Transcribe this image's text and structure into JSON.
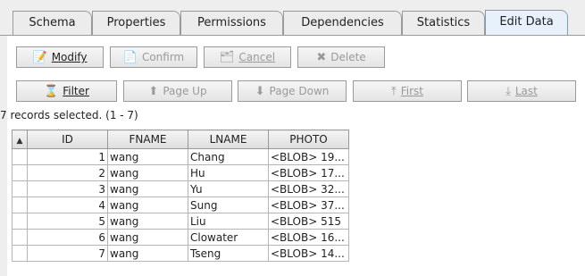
{
  "tabs": [
    {
      "label": "Schema"
    },
    {
      "label": "Properties"
    },
    {
      "label": "Permissions"
    },
    {
      "label": "Dependencies"
    },
    {
      "label": "Statistics"
    },
    {
      "label": "Edit Data"
    }
  ],
  "toolbar": {
    "modify": "Modify",
    "confirm": "Confirm",
    "cancel": "Cancel",
    "delete": "Delete",
    "filter": "Filter",
    "page_up": "Page Up",
    "page_down": "Page Down",
    "first": "First",
    "last": "Last"
  },
  "status": "7 records selected. (1 - 7)",
  "grid": {
    "columns": [
      "ID",
      "FNAME",
      "LNAME",
      "PHOTO"
    ],
    "rows": [
      {
        "id": "1",
        "fname": "wang",
        "lname": "Chang",
        "photo": "<BLOB> 19..."
      },
      {
        "id": "2",
        "fname": "wang",
        "lname": "Hu",
        "photo": "<BLOB> 17..."
      },
      {
        "id": "3",
        "fname": "wang",
        "lname": "Yu",
        "photo": "<BLOB> 32..."
      },
      {
        "id": "4",
        "fname": "wang",
        "lname": "Sung",
        "photo": "<BLOB> 37..."
      },
      {
        "id": "5",
        "fname": "wang",
        "lname": "Liu",
        "photo": "<BLOB> 515"
      },
      {
        "id": "6",
        "fname": "wang",
        "lname": "Clowater",
        "photo": "<BLOB> 16..."
      },
      {
        "id": "7",
        "fname": "wang",
        "lname": "Tseng",
        "photo": "<BLOB> 14..."
      }
    ]
  },
  "icons": {
    "modify": "pencil-icon",
    "confirm": "confirm-icon",
    "cancel": "cancel-icon",
    "delete": "delete-icon",
    "filter": "filter-icon",
    "page_up": "arrow-up-icon",
    "page_down": "arrow-down-icon",
    "first": "first-icon",
    "last": "last-icon",
    "sort": "sort-up-icon"
  },
  "colors": {
    "active_tab": "#e8f1fb",
    "background": "#eeeeee"
  }
}
